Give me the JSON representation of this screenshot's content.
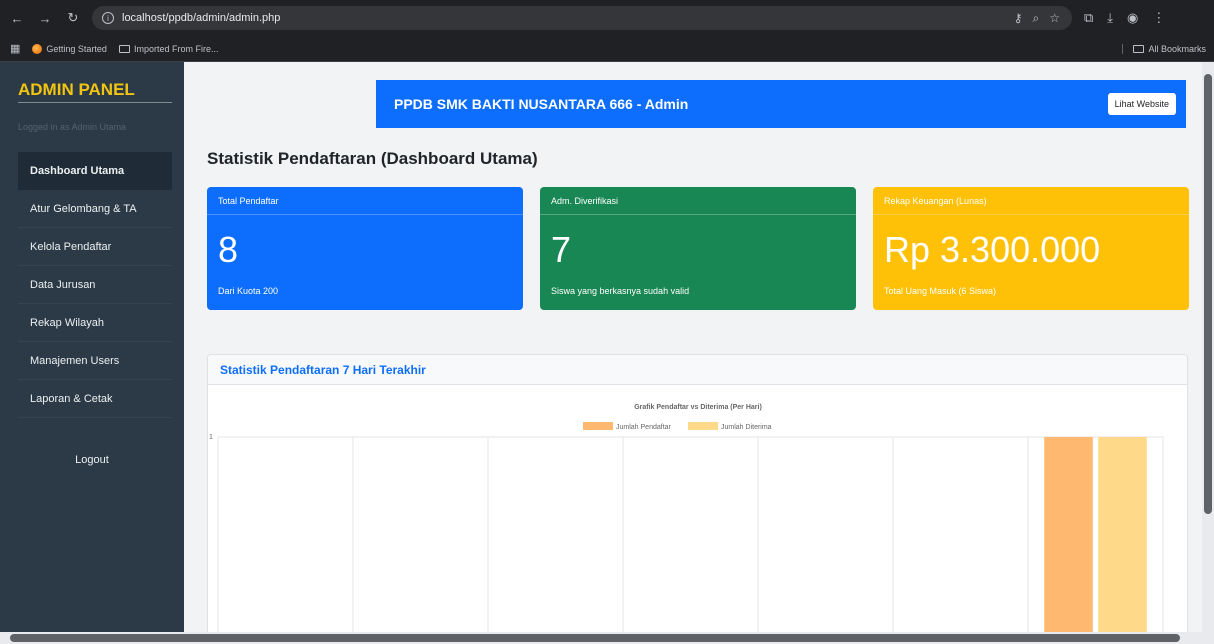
{
  "browser": {
    "url": "localhost/ppdb/admin/admin.php",
    "bookmarks": [
      "Getting Started",
      "Imported From Fire..."
    ],
    "all_bookmarks": "All Bookmarks"
  },
  "sidebar": {
    "title": "ADMIN PANEL",
    "subtitle": "Logged in as Admin Utama",
    "items": [
      {
        "label": "Dashboard Utama",
        "active": true
      },
      {
        "label": "Atur Gelombang & TA"
      },
      {
        "label": "Kelola Pendaftar"
      },
      {
        "label": "Data Jurusan"
      },
      {
        "label": "Rekap Wilayah"
      },
      {
        "label": "Manajemen Users"
      },
      {
        "label": "Laporan & Cetak"
      }
    ],
    "logout": "Logout"
  },
  "header": {
    "title": "PPDB SMK BAKTI NUSANTARA 666 - Admin",
    "button": "Lihat Website"
  },
  "page_title": "Statistik Pendaftaran (Dashboard Utama)",
  "cards": {
    "total": {
      "label": "Total Pendaftar",
      "value": "8",
      "sub": "Dari Kuota 200",
      "color": "#0d6efd"
    },
    "verified": {
      "label": "Adm. Diverifikasi",
      "value": "7",
      "sub": "Siswa yang berkasnya sudah valid",
      "color": "#198754"
    },
    "finance": {
      "label": "Rekap Keuangan (Lunas)",
      "value": "Rp 3.300.000",
      "sub": "Total Uang Masuk (6 Siswa)",
      "color": "#ffc107"
    }
  },
  "chart_section": {
    "title": "Statistik Pendaftaran 7 Hari Terakhir"
  },
  "chart_data": {
    "type": "bar",
    "title": "Grafik Pendaftar vs Diterima (Per Hari)",
    "categories": [
      "",
      "",
      "",
      "",
      "",
      "",
      ""
    ],
    "series": [
      {
        "name": "Jumlah Pendaftar",
        "values": [
          0,
          0,
          0,
          0,
          0,
          0,
          1
        ],
        "color": "#ffb870"
      },
      {
        "name": "Jumlah Diterima",
        "values": [
          0,
          0,
          0,
          0,
          0,
          0,
          1
        ],
        "color": "#ffd98a"
      }
    ],
    "y_ticks": [
      "1"
    ],
    "ylim": [
      0,
      1
    ],
    "legend": "top",
    "grid": true
  }
}
